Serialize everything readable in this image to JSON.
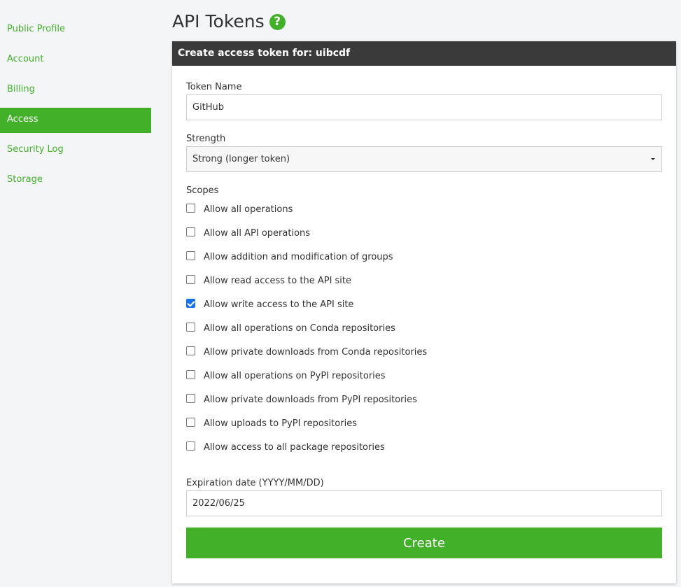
{
  "sidebar": {
    "items": [
      {
        "label": "Public Profile"
      },
      {
        "label": "Account"
      },
      {
        "label": "Billing"
      },
      {
        "label": "Access"
      },
      {
        "label": "Security Log"
      },
      {
        "label": "Storage"
      }
    ],
    "active": "Access"
  },
  "page": {
    "title": "API Tokens",
    "help_icon": "question-circle-icon"
  },
  "form": {
    "header": "Create access token for: uibcdf",
    "token_name_label": "Token Name",
    "token_name_value": "GitHub",
    "strength_label": "Strength",
    "strength_value": "Strong (longer token)",
    "scopes_label": "Scopes",
    "scopes": [
      {
        "label": "Allow all operations",
        "checked": false
      },
      {
        "label": "Allow all API operations",
        "checked": false
      },
      {
        "label": "Allow addition and modification of groups",
        "checked": false
      },
      {
        "label": "Allow read access to the API site",
        "checked": false
      },
      {
        "label": "Allow write access to the API site",
        "checked": true
      },
      {
        "label": "Allow all operations on Conda repositories",
        "checked": false
      },
      {
        "label": "Allow private downloads from Conda repositories",
        "checked": false
      },
      {
        "label": "Allow all operations on PyPI repositories",
        "checked": false
      },
      {
        "label": "Allow private downloads from PyPI repositories",
        "checked": false
      },
      {
        "label": "Allow uploads to PyPI repositories",
        "checked": false
      },
      {
        "label": "Allow access to all package repositories",
        "checked": false
      }
    ],
    "expiration_label": "Expiration date (YYYY/MM/DD)",
    "expiration_value": "2022/06/25",
    "create_label": "Create"
  },
  "colors": {
    "accent": "#43b02a",
    "header_bg": "#3a3a3a",
    "checkbox_checked": "#1a73e8"
  }
}
